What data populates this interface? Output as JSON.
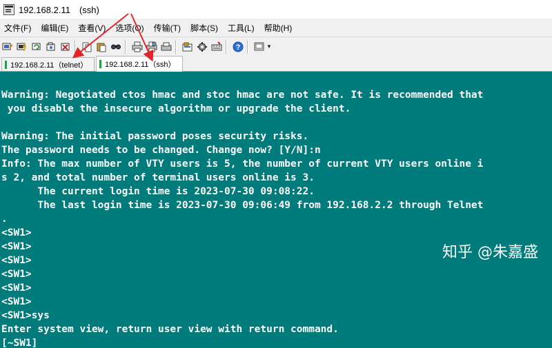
{
  "window": {
    "title": "192.168.2.11　(ssh)"
  },
  "menu": [
    "文件(F)",
    "编辑(E)",
    "查看(V)",
    "选项(O)",
    "传输(T)",
    "脚本(S)",
    "工具(L)",
    "帮助(H)"
  ],
  "toolbar": {
    "icons": [
      "connect-icon",
      "quick-connect-icon",
      "reconnect-icon",
      "connect-in-tab-icon",
      "disconnect-icon",
      "copy-icon",
      "paste-icon",
      "find-icon",
      "print-icon",
      "print-setup-icon",
      "print-screen-icon",
      "session-options-icon",
      "global-options-icon",
      "keymap-icon",
      "help-icon",
      "sftp-icon",
      "dropdown-icon"
    ]
  },
  "tabs": [
    {
      "label": "192.168.2.11（telnet）",
      "status_color": "#17a63c",
      "active": false
    },
    {
      "label": "192.168.2.11（ssh）",
      "status_color": "#17a63c",
      "active": true
    }
  ],
  "terminal": {
    "background": "#007b7b",
    "foreground": "#ffffff",
    "lines": [
      "Warning: Negotiated ctos hmac and stoc hmac are not safe. It is recommended that",
      " you disable the insecure algorithm or upgrade the client.",
      "",
      "Warning: The initial password poses security risks.",
      "The password needs to be changed. Change now? [Y/N]:n",
      "Info: The max number of VTY users is 5, the number of current VTY users online i",
      "s 2, and total number of terminal users online is 3.",
      "      The current login time is 2023-07-30 09:08:22.",
      "      The last login time is 2023-07-30 09:06:49 from 192.168.2.2 through Telnet",
      ".",
      "<SW1>",
      "<SW1>",
      "<SW1>",
      "<SW1>",
      "<SW1>",
      "<SW1>",
      "<SW1>sys",
      "Enter system view, return user view with return command.",
      "[~SW1]"
    ]
  },
  "watermark": "知乎 @朱嘉盛",
  "annotation_color": "#e0262b"
}
